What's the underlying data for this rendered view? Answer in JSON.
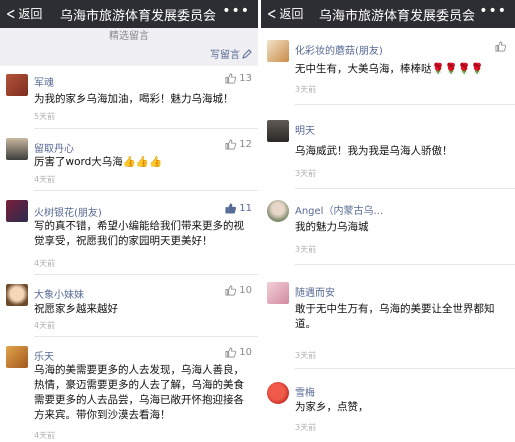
{
  "left": {
    "back": "返回",
    "title": "乌海市旅游体育发展委员会",
    "more": "•••",
    "section_label": "精选留言",
    "write": "写留言",
    "comments": [
      {
        "name": "军魂",
        "likes": "13",
        "text": "为我的家乡乌海加油，喝彩！魅力乌海城！",
        "time": "5天前"
      },
      {
        "name": "留取丹心",
        "likes": "12",
        "text": "厉害了word大乌海👍👍👍",
        "time": "4天前"
      },
      {
        "name": "火树银花(朋友)",
        "likes": "11",
        "text": "写的真不错，希望小编能给我们带来更多的视觉享受，祝愿我们的家园明天更美好！",
        "time": "4天前"
      },
      {
        "name": "大象小妹妹",
        "likes": "10",
        "text": "祝愿家乡越来越好",
        "time": "4天前"
      },
      {
        "name": "乐天",
        "likes": "10",
        "text": "乌海的美需要更多的人去发现，乌海人善良，热情，豪迈需要更多的人去了解，乌海的美食需要更多的人去品尝，乌海已敞开怀抱迎接各方来宾。带你到沙漠去看海！",
        "time": "4天前"
      }
    ]
  },
  "right": {
    "back": "返回",
    "title": "乌海市旅游体育发展委员会",
    "more": "•••",
    "comments": [
      {
        "name": "化彩妆的蘑菇(朋友)",
        "likes": "",
        "text": "无中生有，大美乌海，棒棒哒🌹🌹🌹🌹",
        "time": "3天前"
      },
      {
        "name": "明天",
        "likes": "",
        "text": "乌海威武！我为我是乌海人骄傲！",
        "time": "3天前"
      },
      {
        "name": "Angel（内蒙古乌...",
        "likes": "",
        "text": "我的魅力乌海城",
        "time": "3天前"
      },
      {
        "name": "随遇而安",
        "likes": "",
        "text": "敢于无中生万有，乌海的美要让全世界都知道。",
        "time": "3天前"
      },
      {
        "name": "雪梅",
        "likes": "",
        "text": "为家乡，点赞，",
        "time": "3天前"
      }
    ]
  },
  "colors": {
    "topbar": "#2d2e33",
    "link": "#576b95",
    "bg": "#efeff4"
  }
}
